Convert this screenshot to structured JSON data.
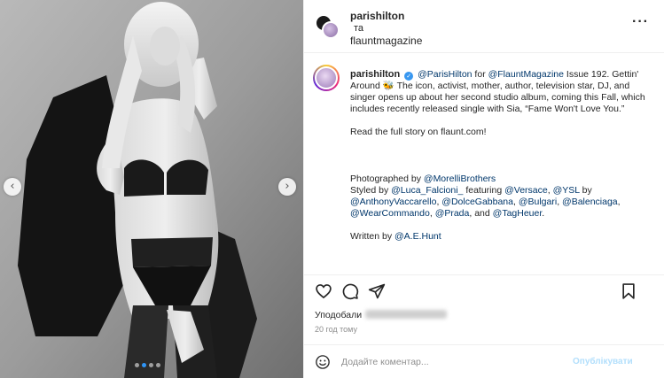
{
  "post": {
    "header": {
      "user1": "parishilton",
      "and": "та",
      "user2": "flauntmagazine",
      "more_icon": "more-horizontal-icon",
      "more_label": "···"
    },
    "caption": {
      "username": "parishilton",
      "verified_icon": "verified-badge-icon",
      "verified_glyph": "✓",
      "lines": [
        {
          "t": "mention",
          "v": "@ParisHilton"
        },
        {
          "t": "text",
          "v": " for "
        },
        {
          "t": "mention",
          "v": "@FlauntMagazine"
        },
        {
          "t": "text",
          "v": " Issue 192. Gettin' Around 🐝 The icon, activist, mother, author, television star, DJ, and singer opens up about her second studio album, coming this Fall, which includes recently released single with Sia, “Fame Won't Love You.”"
        }
      ],
      "read_more": "Read the full story on flaunt.com!",
      "credits_photo": [
        {
          "t": "text",
          "v": "Photographed by "
        },
        {
          "t": "mention",
          "v": "@MorelliBrothers"
        }
      ],
      "credits_style": [
        {
          "t": "text",
          "v": "Styled by "
        },
        {
          "t": "mention",
          "v": "@Luca_Falcioni_"
        },
        {
          "t": "text",
          "v": " featuring "
        },
        {
          "t": "mention",
          "v": "@Versace"
        },
        {
          "t": "text",
          "v": ", "
        },
        {
          "t": "mention",
          "v": "@YSL"
        },
        {
          "t": "text",
          "v": " by "
        },
        {
          "t": "mention",
          "v": "@AnthonyVaccarello"
        },
        {
          "t": "text",
          "v": ", "
        },
        {
          "t": "mention",
          "v": "@DolceGabbana"
        },
        {
          "t": "text",
          "v": ", "
        },
        {
          "t": "mention",
          "v": "@Bulgari"
        },
        {
          "t": "text",
          "v": ", "
        },
        {
          "t": "mention",
          "v": "@Balenciaga"
        },
        {
          "t": "text",
          "v": ", "
        },
        {
          "t": "mention",
          "v": "@WearCommando"
        },
        {
          "t": "text",
          "v": ", "
        },
        {
          "t": "mention",
          "v": "@Prada"
        },
        {
          "t": "text",
          "v": ", and "
        },
        {
          "t": "mention",
          "v": "@TagHeuer"
        },
        {
          "t": "text",
          "v": "."
        }
      ],
      "credits_written": [
        {
          "t": "text",
          "v": "Written by "
        },
        {
          "t": "mention",
          "v": "@A.E.Hunt"
        }
      ]
    },
    "actions": {
      "like_icon": "heart-icon",
      "comment_icon": "comment-icon",
      "share_icon": "share-icon",
      "save_icon": "bookmark-icon"
    },
    "likes_prefix": "Уподобали",
    "time": "20 год тому",
    "comment": {
      "emoji_icon": "emoji-icon",
      "placeholder": "Додайте коментар...",
      "post_label": "Опублікувати"
    },
    "media": {
      "prev_glyph": "‹",
      "next_glyph": "›",
      "slide_count": 4,
      "active_slide": 2
    }
  },
  "colors": {
    "mention": "#00376b",
    "verified": "#3897f0",
    "post_button_disabled": "#b2dffc",
    "dot_active": "#2f95f7"
  }
}
